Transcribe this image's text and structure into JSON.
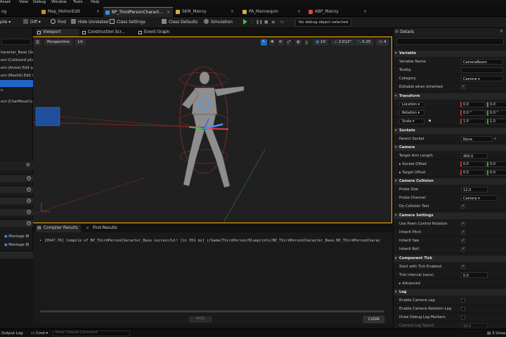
{
  "menu": [
    "Asset",
    "View",
    "Debug",
    "Window",
    "Tools",
    "Help"
  ],
  "tabs": [
    {
      "label": "og",
      "color": "#8a8a8a",
      "active": false
    },
    {
      "label": "Map_MotionEdit",
      "color": "#d28b2a",
      "active": false
    },
    {
      "label": "BP_ThirdPersonCharact...",
      "color": "#3a8de0",
      "active": true
    },
    {
      "label": "SKM_Manny",
      "color": "#d6b03a",
      "active": false
    },
    {
      "label": "PA_Mannequin",
      "color": "#d6b03a",
      "active": false
    },
    {
      "label": "ABP_Manny",
      "color": "#d64a3a",
      "active": false
    }
  ],
  "toolbar": {
    "compile": "pile",
    "diff": "Diff",
    "find": "Find",
    "hide_unrelated": "Hide Unrelated",
    "class_settings": "Class Settings",
    "class_defaults": "Class Defaults",
    "simulation": "Simulation",
    "debug_object": "No debug object selected"
  },
  "left_panel": {
    "rows": [
      {
        "label": "haracter_Base (Self)",
        "selected": false
      },
      {
        "label": "ent (CollisionCylin",
        "selected": false
      },
      {
        "label": "ent (Arrow)  Edit a",
        "selected": false
      },
      {
        "label": "ent (Mesh0)  Edit in C",
        "selected": false
      },
      {
        "label": "",
        "selected": true
      },
      {
        "label": "n",
        "selected": false
      },
      {
        "label": "ent (CharMoveCo",
        "selected": false
      }
    ],
    "montage_1": "Montage Bl",
    "montage_2": "Montage Bl"
  },
  "viewport_tabs": [
    {
      "label": "Viewport",
      "active": true
    },
    {
      "label": "Construction Scr...",
      "active": false
    },
    {
      "label": "Event Graph",
      "active": false
    }
  ],
  "viewport": {
    "perspective": "Perspective",
    "lit": "Lit",
    "grid_size": "10",
    "rot_snap": "2.012°",
    "scale_snap": "0.25",
    "cam_speed": "4"
  },
  "compiler_tabs": [
    {
      "label": "Compiler Results",
      "active": true
    },
    {
      "label": "Find Results",
      "active": false
    }
  ],
  "compiler": {
    "message": "[0947.76] Compile of BP_ThirdPersonCharacter_Base successful! [in 351 ms] (/Game/ThirdPerson/Blueprints/BP_ThirdPersonCharacter_Base.BP_ThirdPersonCharac",
    "page_label": "PAGE",
    "clear_label": "CLEAR"
  },
  "details": {
    "title": "Details",
    "variable_section": "Variable",
    "variable_name_label": "Variable Name",
    "variable_name_value": "CameraBoom",
    "tooltip_label": "Tooltip",
    "category_label": "Category",
    "category_value": "Camera",
    "editable_label": "Editable when Inherited",
    "transform_section": "Transform",
    "location_label": "Location",
    "location_x": "0.0",
    "location_y": "0.0",
    "rotation_label": "Rotation",
    "rotation_x": "0.0 °",
    "rotation_y": "0.0 °",
    "scale_label": "Scale",
    "scale_x": "1.0",
    "scale_y": "1.0",
    "sockets_section": "Sockets",
    "parent_socket_label": "Parent Socket",
    "parent_socket_value": "None",
    "camera_section": "Camera",
    "target_arm_label": "Target Arm Length",
    "target_arm_value": "400.0",
    "socket_offset_label": "Socket Offset",
    "socket_offset_x": "0.0",
    "socket_offset_y": "0.0",
    "target_offset_label": "Target Offset",
    "target_offset_x": "0.0",
    "target_offset_y": "0.0",
    "collision_section": "Camera Collision",
    "probe_size_label": "Probe Size",
    "probe_size_value": "12.0",
    "probe_channel_label": "Probe Channel",
    "probe_channel_value": "Camera",
    "collision_test_label": "Do Collision Test",
    "cam_settings_section": "Camera Settings",
    "use_pawn_label": "Use Pawn Control Rotation",
    "inherit_pitch_label": "Inherit Pitch",
    "inherit_yaw_label": "Inherit Yaw",
    "inherit_roll_label": "Inherit Roll",
    "tick_section": "Component Tick",
    "start_tick_label": "Start with Tick Enabled",
    "tick_interval_label": "Tick Interval (secs)",
    "tick_interval_value": "0.0",
    "advanced_section": "Advanced",
    "lag_section": "Lag",
    "enable_lag_label": "Enable Camera Lag",
    "enable_rot_lag_label": "Enable Camera Rotation Lag",
    "draw_debug_label": "Draw Debug Lag Markers",
    "lag_speed_label": "Camera Lag Speed",
    "lag_speed_value": "10.0"
  },
  "status": {
    "output_log": "Output Log",
    "cmd": "Cmd",
    "console_placeholder": "Enter Console Command",
    "unsaved": "3 Unsa"
  },
  "colors": {
    "accent_blue": "#1e67c8",
    "selection_border": "#ffb000",
    "play_green": "#3fbf3f"
  }
}
